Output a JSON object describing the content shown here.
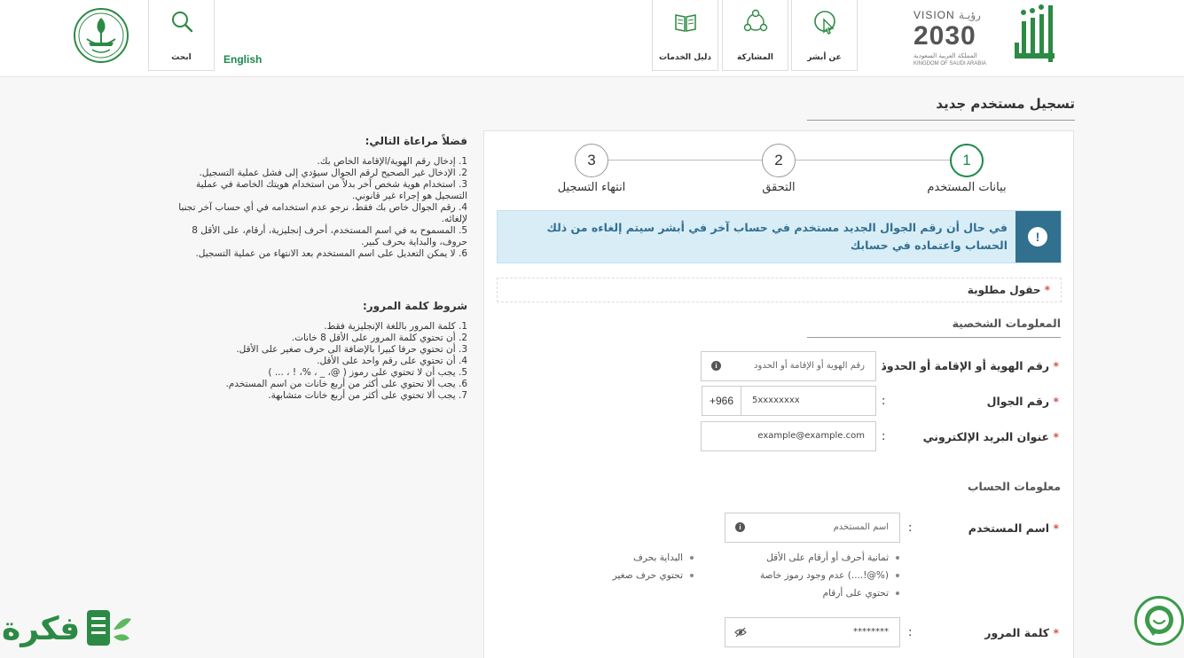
{
  "header": {
    "nav": {
      "about": "عن أبشر",
      "participation": "المشاركة",
      "services_guide": "دليل الخدمات",
      "search": "ابحث"
    },
    "language_link": "English",
    "vision": {
      "title_en": "VISION",
      "title_ar": "رؤيـة",
      "year": "2030",
      "sub_ar": "المملكة العربية السعودية",
      "sub_en": "KINGDOM OF SAUDI ARABIA"
    },
    "brand": "أبشر"
  },
  "page": {
    "title": "تسجيل مستخدم جديد"
  },
  "stepper": {
    "steps": [
      {
        "number": "1",
        "label": "بيانات المستخدم",
        "active": true
      },
      {
        "number": "2",
        "label": "التحقق",
        "active": false
      },
      {
        "number": "3",
        "label": "انتهاء التسجيل",
        "active": false
      }
    ]
  },
  "alert": {
    "text": "في حال أن رقم الجوال الجديد مستخدم في حساب آخر في أبشر سيتم إلغاءه من ذلك الحساب واعتماده في حسابك"
  },
  "form": {
    "required_note": "حقول مطلوبة",
    "required_star": "*",
    "personal_section": "المعلومات الشخصية",
    "account_section": "معلومات الحساب",
    "colon": ":",
    "id_label": "رقم الهوية أو الإقامة أو الحدود",
    "id_placeholder": "رقم الهوية أو الإقامة أو الحدود",
    "mobile_label": "رقم الجوال",
    "mobile_prefix": "+966",
    "mobile_placeholder": "5xxxxxxxx",
    "email_label": "عنوان البريد الإلكتروني",
    "email_placeholder": "example@example.com",
    "username_label": "اسم المستخدم",
    "username_placeholder": "اسم المستخدم",
    "username_hints": [
      "ثمانية أحرف أو أرقام على الأقل",
      "عدم وجود رموز خاصة (....!@%)",
      "تحتوي على أرقام",
      "البداية بحرف",
      "تحتوي حرف صغير"
    ],
    "password_label": "كلمة المرور",
    "password_value": "********"
  },
  "instructions": {
    "notes_title": "فضلاً مراعاة التالي:",
    "notes": [
      "1. إدخال رقم الهوية/الإقامة الخاص بك.",
      "2. الإدخال غير الصحيح لرقم الجوال سيؤدي إلى فشل عملية التسجيل.",
      "3. استخدام هوية شخص آخر بدلاً من استخدام هويتك الخاصة في عملية التسجيل هو إجراء غير قانوني.",
      "4. رقم الجوال خاص بك فقط، نرجو عدم استخدامه في أي حساب آخر تجنبا لإلغائه.",
      "5. المسموح به في اسم المستخدم، أحرف إنجليزية، أرقام، على الأقل 8 حروف، والبداية بحرف كبير.",
      "6. لا يمكن التعديل على اسم المستخدم بعد الانتهاء من عملية التسجيل."
    ],
    "password_title": "شروط كلمة المرور:",
    "password_rules": [
      "1. كلمة المرور باللغة الإنجليزية فقط.",
      "2. أن تحتوي كلمة المرور على الأقل 8 خانات.",
      "3. أن تحتوي حرفا كبيرا بالإضافة الى حرف صغير على الأقل.",
      "4. أن تحتوي على رقم واحد على الأقل.",
      "5. يجب أن لا تحتوي على رموز ( @، _ ، %، ! ، ... )",
      "6. يجب ألا تحتوي على أكثر من أربع خانات من اسم المستخدم.",
      "7. يجب ألا تحتوي على أكثر من أربع خانات متشابهة."
    ]
  },
  "footer": {
    "brand": "فكرة"
  },
  "colors": {
    "green": "#1a8a4a",
    "alert_bg": "#d9edf7",
    "alert_text": "#31708f",
    "required": "#d9534f"
  }
}
